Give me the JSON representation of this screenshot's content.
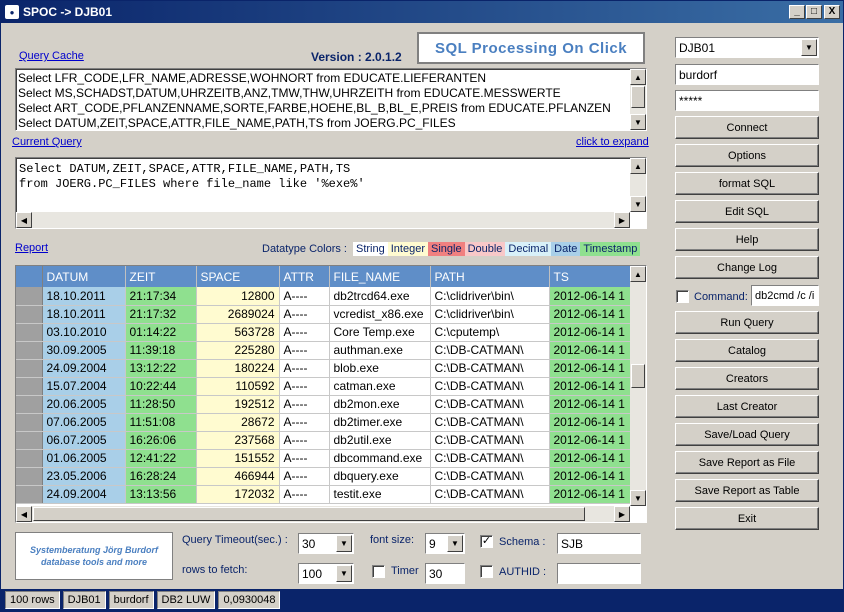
{
  "window": {
    "title": "SPOC -> DJB01",
    "min": "_",
    "max": "□",
    "close": "X"
  },
  "header": {
    "query_cache_link": "Query Cache",
    "version": "Version : 2.0.1.2",
    "logo": "SQL Processing On Click"
  },
  "query_cache": [
    "Select LFR_CODE,LFR_NAME,ADRESSE,WOHNORT from EDUCATE.LIEFERANTEN",
    "Select MS,SCHADST,DATUM,UHRZEITB,ANZ,TMW,THW,UHRZEITH from EDUCATE.MESSWERTE",
    "Select ART_CODE,PFLANZENNAME,SORTE,FARBE,HOEHE,BL_B,BL_E,PREIS from EDUCATE.PFLANZEN",
    "Select DATUM,ZEIT,SPACE,ATTR,FILE_NAME,PATH,TS from JOERG.PC_FILES"
  ],
  "current_query": {
    "label": "Current Query",
    "expand_link": "click to expand",
    "lines": [
      "Select DATUM,ZEIT,SPACE,ATTR,FILE_NAME,PATH,TS",
      "from JOERG.PC_FILES where file_name like '%exe%'"
    ]
  },
  "report": {
    "label": "Report",
    "datatype_label": "Datatype Colors :",
    "datatypes": [
      {
        "name": "String",
        "color": "#ffffff"
      },
      {
        "name": "Integer",
        "color": "#fffbd0"
      },
      {
        "name": "Single",
        "color": "#f08080"
      },
      {
        "name": "Double",
        "color": "#f8c8c8"
      },
      {
        "name": "Decimal",
        "color": "#d8f0f8"
      },
      {
        "name": "Date",
        "color": "#a9cfe8"
      },
      {
        "name": "Timestamp",
        "color": "#8fe08f"
      }
    ]
  },
  "grid": {
    "columns": [
      "DATUM",
      "ZEIT",
      "SPACE",
      "ATTR",
      "FILE_NAME",
      "PATH",
      "TS"
    ],
    "rows": [
      [
        "18.10.2011",
        "21:17:34",
        "12800",
        "A----",
        "db2trcd64.exe",
        "C:\\clidriver\\bin\\",
        "2012-06-14 1"
      ],
      [
        "18.10.2011",
        "21:17:32",
        "2689024",
        "A----",
        "vcredist_x86.exe",
        "C:\\clidriver\\bin\\",
        "2012-06-14 1"
      ],
      [
        "03.10.2010",
        "01:14:22",
        "563728",
        "A----",
        "Core Temp.exe",
        "C:\\cputemp\\",
        "2012-06-14 1"
      ],
      [
        "30.09.2005",
        "11:39:18",
        "225280",
        "A----",
        "authman.exe",
        "C:\\DB-CATMAN\\",
        "2012-06-14 1"
      ],
      [
        "24.09.2004",
        "13:12:22",
        "180224",
        "A----",
        "blob.exe",
        "C:\\DB-CATMAN\\",
        "2012-06-14 1"
      ],
      [
        "15.07.2004",
        "10:22:44",
        "110592",
        "A----",
        "catman.exe",
        "C:\\DB-CATMAN\\",
        "2012-06-14 1"
      ],
      [
        "20.06.2005",
        "11:28:50",
        "192512",
        "A----",
        "db2mon.exe",
        "C:\\DB-CATMAN\\",
        "2012-06-14 1"
      ],
      [
        "07.06.2005",
        "11:51:08",
        "28672",
        "A----",
        "db2timer.exe",
        "C:\\DB-CATMAN\\",
        "2012-06-14 1"
      ],
      [
        "06.07.2005",
        "16:26:06",
        "237568",
        "A----",
        "db2util.exe",
        "C:\\DB-CATMAN\\",
        "2012-06-14 1"
      ],
      [
        "01.06.2005",
        "12:41:22",
        "151552",
        "A----",
        "dbcommand.exe",
        "C:\\DB-CATMAN\\",
        "2012-06-14 1"
      ],
      [
        "23.05.2006",
        "16:28:24",
        "466944",
        "A----",
        "dbquery.exe",
        "C:\\DB-CATMAN\\",
        "2012-06-14 1"
      ],
      [
        "24.09.2004",
        "13:13:56",
        "172032",
        "A----",
        "testit.exe",
        "C:\\DB-CATMAN\\",
        "2012-06-14 1"
      ]
    ]
  },
  "bottom": {
    "brand_line1": "Systemberatung Jörg Burdorf",
    "brand_line2": "database tools and more",
    "timeout_label": "Query Timeout(sec.) :",
    "timeout_value": "30",
    "rows_label": "rows to fetch:",
    "rows_value": "100",
    "fontsize_label": "font size:",
    "fontsize_value": "9",
    "timer_label": "Timer",
    "timer_value": "30",
    "schema_label": "Schema :",
    "schema_value": "SJB",
    "authid_label": "AUTHID :",
    "authid_value": ""
  },
  "right": {
    "db_value": "DJB01",
    "user_value": "burdorf",
    "password_value": "*****",
    "command_label": "Command:",
    "command_value": "db2cmd /c /i",
    "buttons": [
      "Connect",
      "Options",
      "format SQL",
      "Edit SQL",
      "Help",
      "Change Log",
      "Run Query",
      "Catalog",
      "Creators",
      "Last Creator",
      "Save/Load Query",
      "Save Report as File",
      "Save Report as Table",
      "Exit"
    ]
  },
  "statusbar": [
    "100 rows",
    "DJB01",
    "burdorf",
    "DB2 LUW",
    "0,0930048"
  ]
}
